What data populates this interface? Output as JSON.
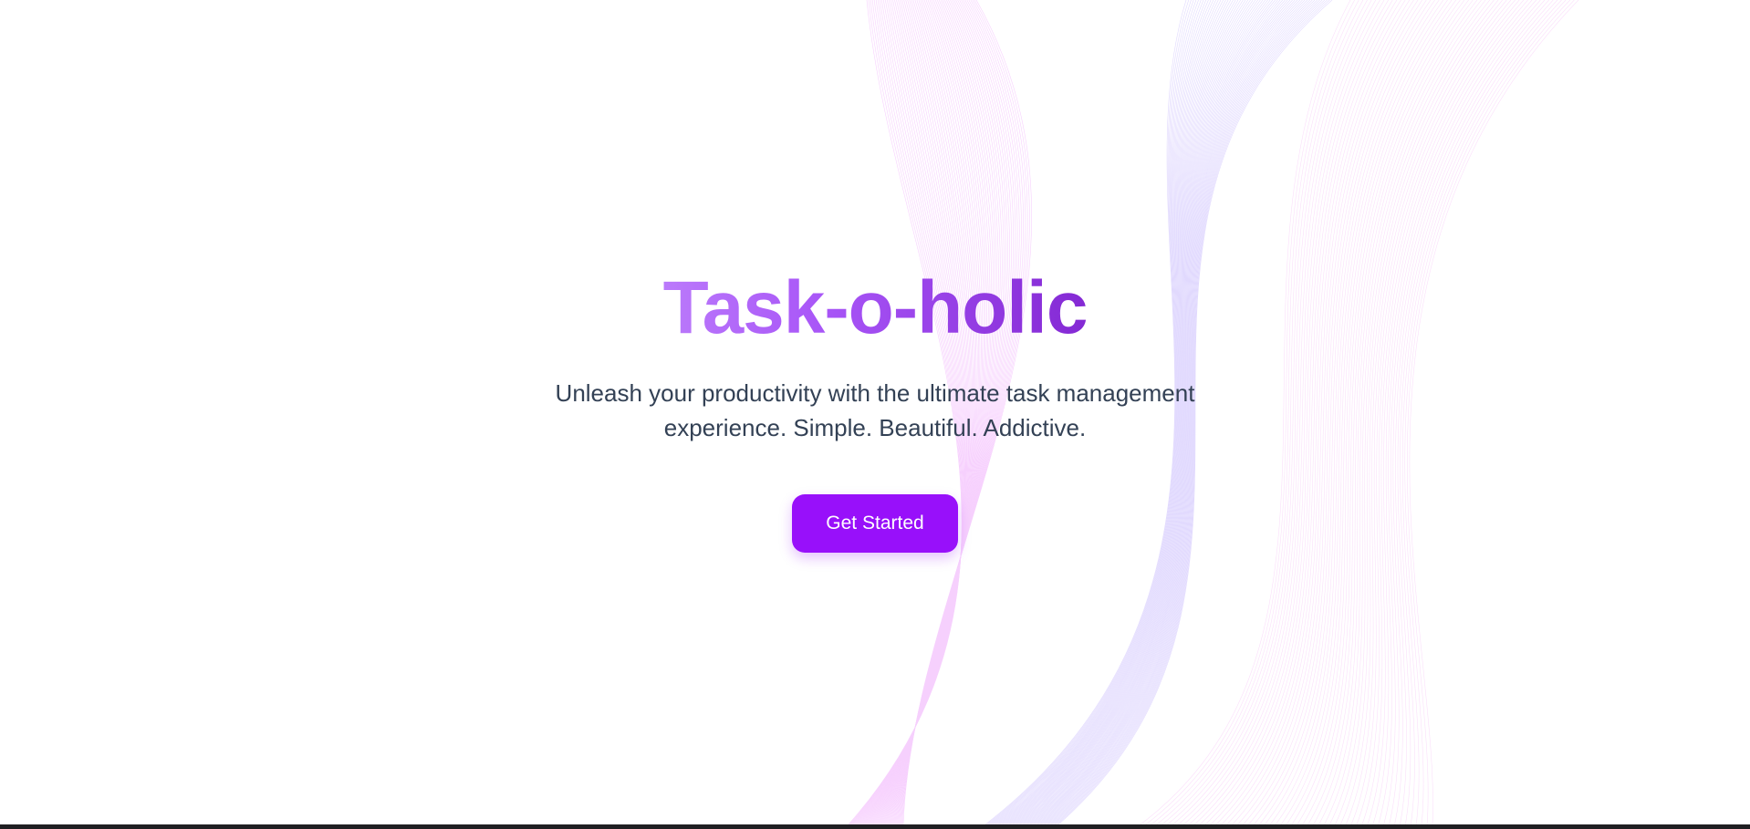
{
  "hero": {
    "title": "Task-o-holic",
    "subtitle": "Unleash your productivity with the ultimate task management experience. Simple. Beautiful. Addictive.",
    "cta_label": "Get Started"
  },
  "colors": {
    "title_gradient_start": "#c084fc",
    "title_gradient_end": "#7e22ce",
    "cta_background": "#9810fa",
    "cta_text": "#ffffff",
    "subtitle_text": "#334155",
    "wave_pink": "#f0abfc",
    "wave_lavender": "#c4b5fd"
  }
}
